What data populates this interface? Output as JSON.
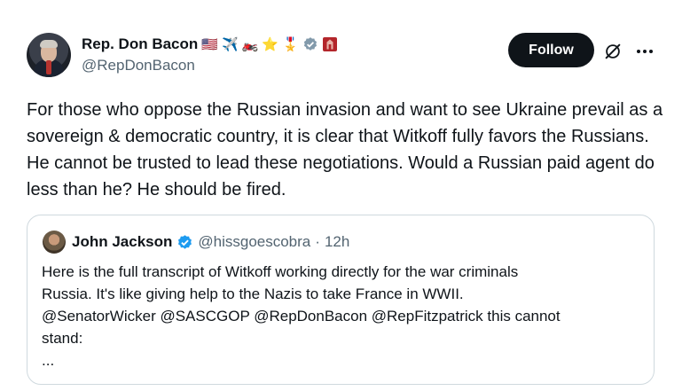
{
  "post": {
    "author": {
      "display_name": "Rep. Don Bacon",
      "name_emojis": [
        "🇺🇸",
        "✈️",
        "🏍️",
        "⭐",
        "🎖️"
      ],
      "verified_badge": "gray-verified-badge-icon",
      "affiliation_badge": "red-affiliate-badge-icon",
      "handle": "@RepDonBacon"
    },
    "follow_label": "Follow",
    "text": "For those who oppose the Russian invasion and want to see Ukraine prevail as a sovereign & democratic country, it is clear that Witkoff fully favors the Russians. He cannot be trusted to lead these negotiations. Would a Russian paid agent do less than he? He should be fired."
  },
  "quote": {
    "author": {
      "display_name": "John Jackson",
      "verified_badge": "blue-verified-badge-icon",
      "handle": "@hissgoescobra",
      "separator": "·",
      "time": "12h"
    },
    "text": "Here is the full transcript of Witkoff working directly for the war criminals\nRussia.  It's like giving help to the Nazis to take France in WWII.\n@SenatorWicker @SASCGOP @RepDonBacon @RepFitzpatrick this cannot\nstand:\n..."
  },
  "colors": {
    "text_primary": "#0f1419",
    "text_secondary": "#536471",
    "follow_bg": "#0f1419",
    "blue_badge": "#1d9bf0",
    "gray_badge": "#829aab",
    "border": "#cfd9de"
  }
}
